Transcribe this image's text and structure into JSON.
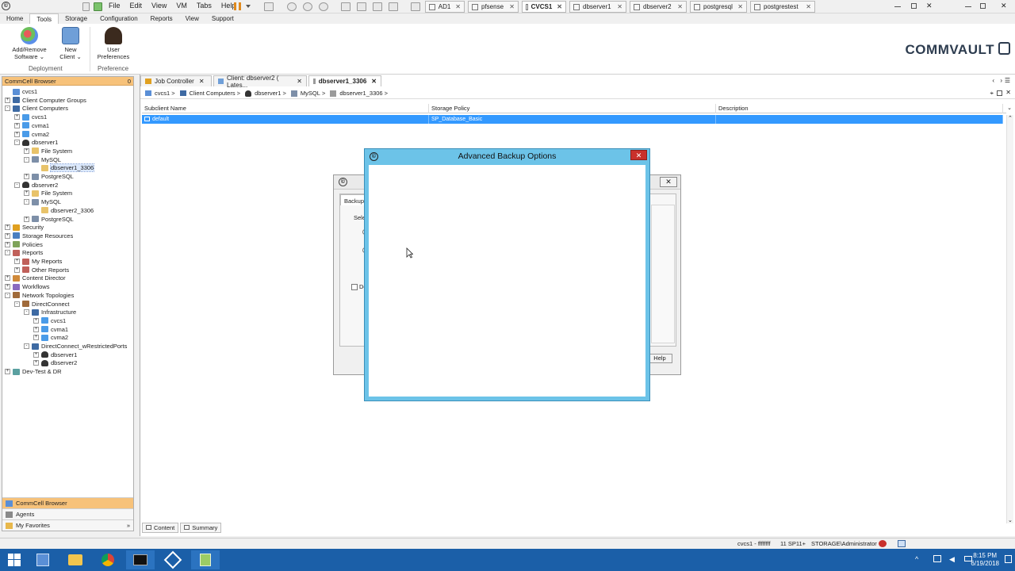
{
  "menubar": {
    "items": [
      "File",
      "Edit",
      "View",
      "VM",
      "Tabs",
      "Help"
    ],
    "vm_tabs": [
      {
        "label": "AD1",
        "active": false
      },
      {
        "label": "pfsense",
        "active": false
      },
      {
        "label": "CVCS1",
        "active": true
      },
      {
        "label": "dbserver1",
        "active": false
      },
      {
        "label": "dbserver2",
        "active": false
      },
      {
        "label": "postgresql",
        "active": false
      },
      {
        "label": "postgrestest",
        "active": false
      }
    ]
  },
  "ribbon": {
    "tabs": [
      "Home",
      "Tools",
      "Storage",
      "Configuration",
      "Reports",
      "View",
      "Support"
    ],
    "active_tab": "Tools",
    "buttons": {
      "add_remove": "Add/Remove",
      "add_remove_2": "Software",
      "new_client": "New",
      "new_client_2": "Client",
      "user_prefs": "User",
      "user_prefs_2": "Preferences"
    },
    "groups": {
      "deployment": "Deployment",
      "preference": "Preference"
    },
    "logo": "COMMVAULT"
  },
  "left_panel": {
    "header": "CommCell Browser",
    "header_count": "0",
    "tree": [
      {
        "label": "cvcs1",
        "level": 0,
        "exp": "",
        "icon": "server"
      },
      {
        "label": "Client Computer Groups",
        "level": 0,
        "exp": "+",
        "icon": "group"
      },
      {
        "label": "Client Computers",
        "level": 0,
        "exp": "-",
        "icon": "group"
      },
      {
        "label": "cvcs1",
        "level": 1,
        "exp": "+",
        "icon": "windows"
      },
      {
        "label": "cvma1",
        "level": 1,
        "exp": "+",
        "icon": "windows"
      },
      {
        "label": "cvma2",
        "level": 1,
        "exp": "+",
        "icon": "windows"
      },
      {
        "label": "dbserver1",
        "level": 1,
        "exp": "-",
        "icon": "linux"
      },
      {
        "label": "File System",
        "level": 2,
        "exp": "+",
        "icon": "folder"
      },
      {
        "label": "MySQL",
        "level": 2,
        "exp": "-",
        "icon": "db"
      },
      {
        "label": "dbserver1_3306",
        "level": 3,
        "exp": "",
        "icon": "folder",
        "selected": true
      },
      {
        "label": "PostgreSQL",
        "level": 2,
        "exp": "+",
        "icon": "db"
      },
      {
        "label": "dbserver2",
        "level": 1,
        "exp": "-",
        "icon": "linux"
      },
      {
        "label": "File System",
        "level": 2,
        "exp": "+",
        "icon": "folder"
      },
      {
        "label": "MySQL",
        "level": 2,
        "exp": "-",
        "icon": "db"
      },
      {
        "label": "dbserver2_3306",
        "level": 3,
        "exp": "",
        "icon": "folder"
      },
      {
        "label": "PostgreSQL",
        "level": 2,
        "exp": "+",
        "icon": "db"
      },
      {
        "label": "Security",
        "level": 0,
        "exp": "+",
        "icon": "security"
      },
      {
        "label": "Storage Resources",
        "level": 0,
        "exp": "+",
        "icon": "storage"
      },
      {
        "label": "Policies",
        "level": 0,
        "exp": "+",
        "icon": "policy"
      },
      {
        "label": "Reports",
        "level": 0,
        "exp": "-",
        "icon": "report"
      },
      {
        "label": "My Reports",
        "level": 1,
        "exp": "+",
        "icon": "report"
      },
      {
        "label": "Other Reports",
        "level": 1,
        "exp": "+",
        "icon": "report"
      },
      {
        "label": "Content Director",
        "level": 0,
        "exp": "+",
        "icon": "content"
      },
      {
        "label": "Workflows",
        "level": 0,
        "exp": "+",
        "icon": "workflow"
      },
      {
        "label": "Network Topologies",
        "level": 0,
        "exp": "-",
        "icon": "network"
      },
      {
        "label": "DirectConnect",
        "level": 1,
        "exp": "-",
        "icon": "network"
      },
      {
        "label": "Infrastructure",
        "level": 2,
        "exp": "-",
        "icon": "group"
      },
      {
        "label": "cvcs1",
        "level": 3,
        "exp": "+",
        "icon": "windows"
      },
      {
        "label": "cvma1",
        "level": 3,
        "exp": "+",
        "icon": "windows"
      },
      {
        "label": "cvma2",
        "level": 3,
        "exp": "+",
        "icon": "windows"
      },
      {
        "label": "DirectConnect_wRestrictedPorts",
        "level": 2,
        "exp": "-",
        "icon": "group"
      },
      {
        "label": "dbserver1",
        "level": 3,
        "exp": "+",
        "icon": "linux"
      },
      {
        "label": "dbserver2",
        "level": 3,
        "exp": "+",
        "icon": "linux"
      },
      {
        "label": "Dev-Test & DR",
        "level": 0,
        "exp": "+",
        "icon": "devtest"
      }
    ],
    "bottom": [
      "CommCell Browser",
      "Agents",
      "My Favorites"
    ]
  },
  "content": {
    "tabs": [
      {
        "label": "Job Controller",
        "active": false
      },
      {
        "label": "Client: dbserver2 ( Lates...",
        "active": false
      },
      {
        "label": "dbserver1_3306",
        "active": true
      }
    ],
    "breadcrumb": [
      "cvcs1",
      "Client Computers",
      "dbserver1",
      "MySQL",
      "dbserver1_3306"
    ],
    "columns": [
      "Subclient Name",
      "Storage Policy",
      "Description"
    ],
    "rows": [
      {
        "name": "default",
        "policy": "SP_Database_Basic",
        "description": ""
      }
    ],
    "bottom_tabs": [
      "Content",
      "Summary"
    ]
  },
  "dialog_bg": {
    "tab": "Backup O",
    "select_label": "Selec",
    "checkbox_label": "De",
    "help": "Help",
    "close": "✕"
  },
  "dialog": {
    "title": "Advanced Backup Options",
    "close": "✕"
  },
  "status": {
    "host": "cvcs1 - ffffffff",
    "version": "11 SP11+",
    "user": "STORAGE\\Administrator"
  },
  "taskbar": {
    "time": "8:15 PM",
    "date": "6/19/2018"
  },
  "colors": {
    "accent_orange": "#f7c27a",
    "dialog_frame": "#6cc3e8",
    "selection": "#3399ff",
    "taskbar": "#1b5fa8"
  }
}
